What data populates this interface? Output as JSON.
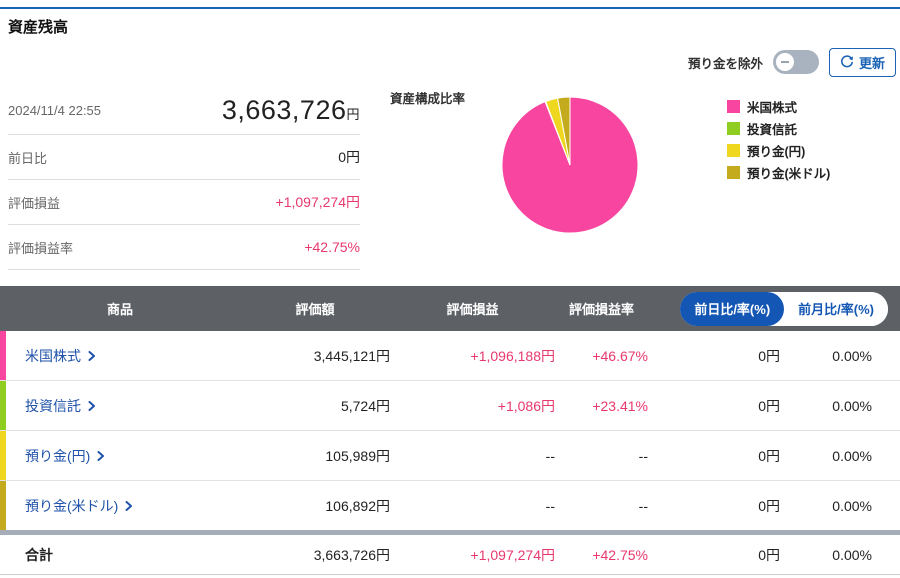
{
  "page": {
    "title": "資産残高"
  },
  "controls": {
    "toggle_label": "預り金を除外",
    "toggle_state": "off",
    "refresh_label": "更新"
  },
  "summary": {
    "timestamp": "2024/11/4 22:55",
    "total_value": "3,663,726",
    "total_unit": "円",
    "rows": [
      {
        "label": "前日比",
        "value": "0円",
        "color": "black"
      },
      {
        "label": "評価損益",
        "value": "+1,097,274円",
        "color": "pink"
      },
      {
        "label": "評価損益率",
        "value": "+42.75%",
        "color": "pink"
      }
    ]
  },
  "chart_data": {
    "type": "pie",
    "title": "資産構成比率",
    "labels": [
      "米国株式",
      "投資信託",
      "預り金(円)",
      "預り金(米ドル)"
    ],
    "values": [
      3445121,
      5724,
      105989,
      106892
    ],
    "percents": [
      94.03,
      0.16,
      2.89,
      2.92
    ],
    "colors": [
      "#f8459f",
      "#8fce21",
      "#efd71f",
      "#c4ab1e"
    ],
    "legend_position": "right",
    "start_angle": "12-oclock-clockwise"
  },
  "table": {
    "headers": [
      "商品",
      "評価額",
      "評価損益",
      "評価損益率"
    ],
    "period_toggle": {
      "selected": "前日比/率(%)",
      "other": "前月比/率(%)"
    },
    "rows": [
      {
        "name": "米国株式",
        "color": "#f8459f",
        "amount": "3,445,121円",
        "pl": "+1,096,188円",
        "pl_rate": "+46.67%",
        "day_change": "0円",
        "day_rate": "0.00%"
      },
      {
        "name": "投資信託",
        "color": "#8fce21",
        "amount": "5,724円",
        "pl": "+1,086円",
        "pl_rate": "+23.41%",
        "day_change": "0円",
        "day_rate": "0.00%"
      },
      {
        "name": "預り金(円)",
        "color": "#efd71f",
        "amount": "105,989円",
        "pl": "--",
        "pl_rate": "--",
        "day_change": "0円",
        "day_rate": "0.00%"
      },
      {
        "name": "預り金(米ドル)",
        "color": "#c4ab1e",
        "amount": "106,892円",
        "pl": "--",
        "pl_rate": "--",
        "day_change": "0円",
        "day_rate": "0.00%"
      }
    ],
    "total": {
      "name": "合計",
      "amount": "3,663,726円",
      "pl": "+1,097,274円",
      "pl_rate": "+42.75%",
      "day_change": "0円",
      "day_rate": "0.00%"
    }
  },
  "colors": {
    "accent_blue": "#1b63b5",
    "pill_blue": "#1456b3",
    "link_blue": "#1f52a8",
    "pink_text": "#e8386d",
    "header_bg": "#5d6166",
    "toggle_track": "#a9b3bf",
    "thick_divider": "#a5aeb8"
  }
}
